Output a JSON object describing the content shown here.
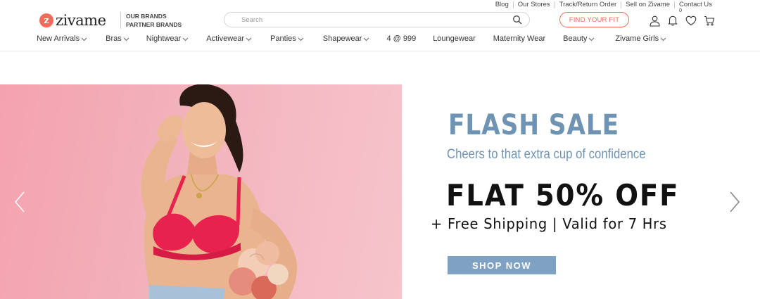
{
  "util_links": [
    "Blog",
    "Our Stores",
    "Track/Return Order",
    "Sell on Zivame",
    "Contact Us"
  ],
  "logo": {
    "mark": "z",
    "text": "zivame"
  },
  "brands": {
    "line1": "OUR BRANDS",
    "line2": "PARTNER BRANDS"
  },
  "search": {
    "placeholder": "Search",
    "icon": "search-icon"
  },
  "find_fit": "FIND YOUR FIT",
  "header_icons": {
    "account": "user-icon",
    "notifications": "bell-icon",
    "notification_count": "0",
    "wishlist": "heart-icon",
    "cart": "cart-icon"
  },
  "nav": [
    {
      "label": "New Arrivals",
      "dropdown": true
    },
    {
      "label": "Bras",
      "dropdown": true
    },
    {
      "label": "Nightwear",
      "dropdown": true
    },
    {
      "label": "Activewear",
      "dropdown": true
    },
    {
      "label": "Panties",
      "dropdown": true
    },
    {
      "label": "Shapewear",
      "dropdown": true
    },
    {
      "label": "4 @ 999",
      "dropdown": false
    },
    {
      "label": "Loungewear",
      "dropdown": false
    },
    {
      "label": "Maternity Wear",
      "dropdown": false
    },
    {
      "label": "Beauty",
      "dropdown": true
    },
    {
      "label": "Zivame Girls",
      "dropdown": true
    }
  ],
  "banner": {
    "title": "FLASH SALE",
    "subtitle": "Cheers to that extra cup of confidence",
    "offer": "FLAT 50% OFF",
    "extra": "+ Free Shipping | Valid for 7 Hrs",
    "cta": "SHOP NOW",
    "colors": {
      "accent": "#6f93b3",
      "button": "#7fa2c4",
      "photo_bg": "#f4a2ae",
      "bra": "#e8224e"
    }
  },
  "colors": {
    "brand": "#f26a5b"
  }
}
